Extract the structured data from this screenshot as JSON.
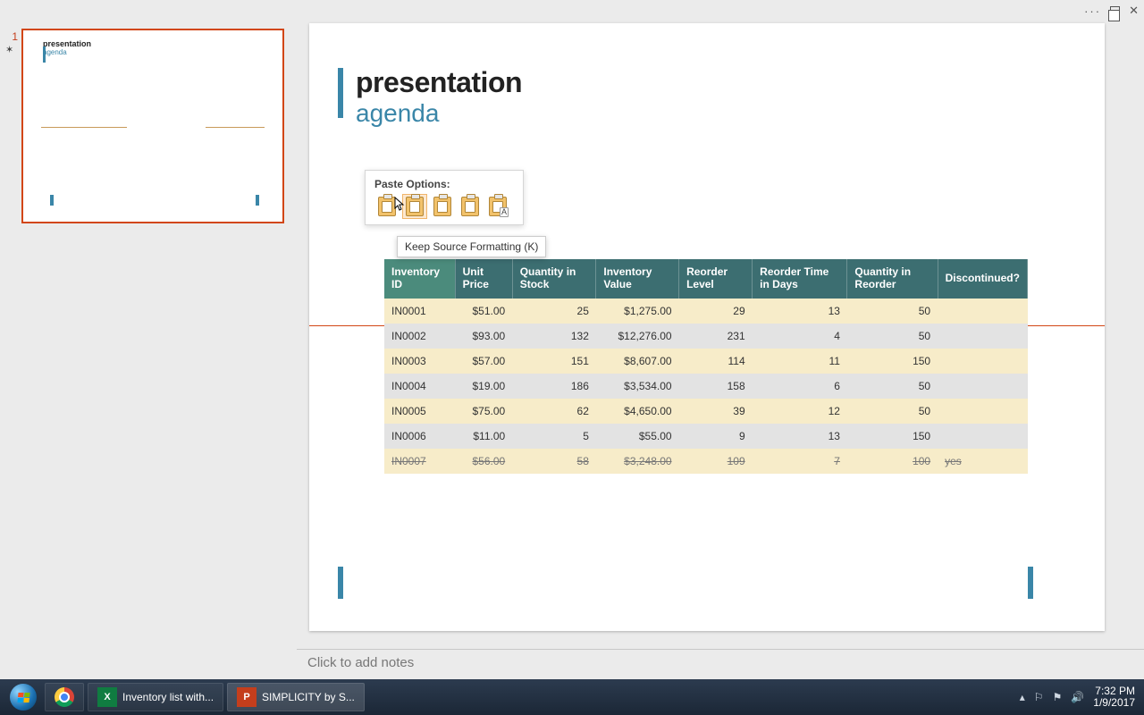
{
  "window_controls": {
    "ellipsis": "···",
    "close": "✕"
  },
  "thumbnail": {
    "index": "1",
    "title": "presentation",
    "subtitle": "agenda"
  },
  "slide": {
    "title": "presentation",
    "subtitle": "agenda"
  },
  "paste_options": {
    "label": "Paste Options:",
    "tooltip": "Keep Source Formatting (K)",
    "items": [
      {
        "name": "use-destination-theme",
        "badge": ""
      },
      {
        "name": "keep-source-formatting",
        "badge": ""
      },
      {
        "name": "embed",
        "badge": ""
      },
      {
        "name": "picture",
        "badge": ""
      },
      {
        "name": "text-only",
        "badge": "A"
      }
    ]
  },
  "table": {
    "headers": [
      "Inventory ID",
      "Unit Price",
      "Quantity in Stock",
      "Inventory Value",
      "Reorder Level",
      "Reorder Time in Days",
      "Quantity in Reorder",
      "Discontinued?"
    ],
    "rows": [
      {
        "id": "IN0001",
        "price": "$51.00",
        "qty": "25",
        "value": "$1,275.00",
        "reorder": "29",
        "days": "13",
        "qreorder": "50",
        "disc": ""
      },
      {
        "id": "IN0002",
        "price": "$93.00",
        "qty": "132",
        "value": "$12,276.00",
        "reorder": "231",
        "days": "4",
        "qreorder": "50",
        "disc": ""
      },
      {
        "id": "IN0003",
        "price": "$57.00",
        "qty": "151",
        "value": "$8,607.00",
        "reorder": "114",
        "days": "11",
        "qreorder": "150",
        "disc": ""
      },
      {
        "id": "IN0004",
        "price": "$19.00",
        "qty": "186",
        "value": "$3,534.00",
        "reorder": "158",
        "days": "6",
        "qreorder": "50",
        "disc": ""
      },
      {
        "id": "IN0005",
        "price": "$75.00",
        "qty": "62",
        "value": "$4,650.00",
        "reorder": "39",
        "days": "12",
        "qreorder": "50",
        "disc": ""
      },
      {
        "id": "IN0006",
        "price": "$11.00",
        "qty": "5",
        "value": "$55.00",
        "reorder": "9",
        "days": "13",
        "qreorder": "150",
        "disc": ""
      },
      {
        "id": "IN0007",
        "price": "$56.00",
        "qty": "58",
        "value": "$3,248.00",
        "reorder": "109",
        "days": "7",
        "qreorder": "100",
        "disc": "yes",
        "struck": true
      }
    ]
  },
  "notes_placeholder": "Click to add notes",
  "taskbar": {
    "excel": {
      "label": "Inventory list with...",
      "icon_text": "X"
    },
    "ppt": {
      "label": "SIMPLICITY by S...",
      "icon_text": "P"
    },
    "time": "7:32 PM",
    "date": "1/9/2017"
  }
}
